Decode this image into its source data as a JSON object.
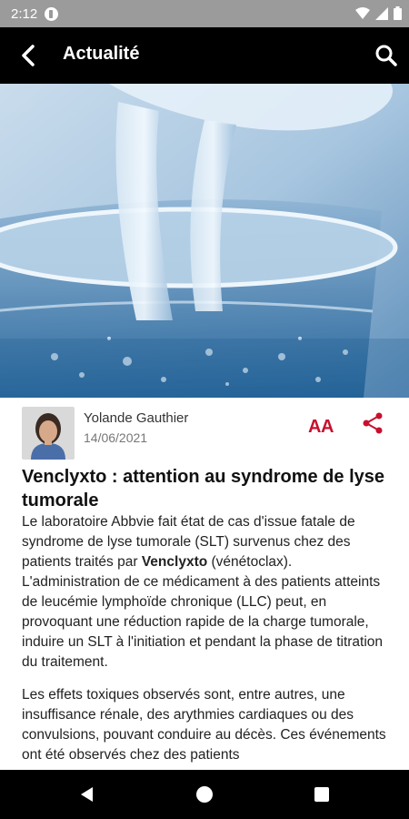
{
  "status_bar": {
    "time": "2:12"
  },
  "app_bar": {
    "title": "Actualité"
  },
  "article": {
    "author": "Yolande Gauthier",
    "date": "14/06/2021",
    "font_size_label": "AA",
    "title": "Venclyxto : attention au syndrome de lyse tumorale",
    "p1_before": "Le laboratoire Abbvie fait état de cas d'issue fatale de syndrome de lyse tumorale (SLT) survenus chez des patients traités par ",
    "p1_bold": "Venclyxto",
    "p1_after": " (vénétoclax). L'administration de ce médicament à des patients atteints de leucémie lymphoïde chronique (LLC) peut, en provoquant une réduction rapide de la charge tumorale, induire un SLT à l'initiation et pendant la phase de titration du traitement.",
    "p2": "Les effets toxiques observés sont, entre autres, une insuffisance rénale, des arythmies cardiaques ou des convulsions, pouvant conduire au décès. Ces événements ont été observés chez des patients"
  },
  "colors": {
    "accent": "#c8102e",
    "app_bar": "#000000",
    "status_bar": "#9b9b9b"
  },
  "icons": [
    "back-arrow-icon",
    "search-icon",
    "text-size-icon",
    "share-icon",
    "wifi-icon",
    "signal-icon",
    "battery-icon",
    "nav-back-icon",
    "nav-home-icon",
    "nav-recents-icon"
  ]
}
